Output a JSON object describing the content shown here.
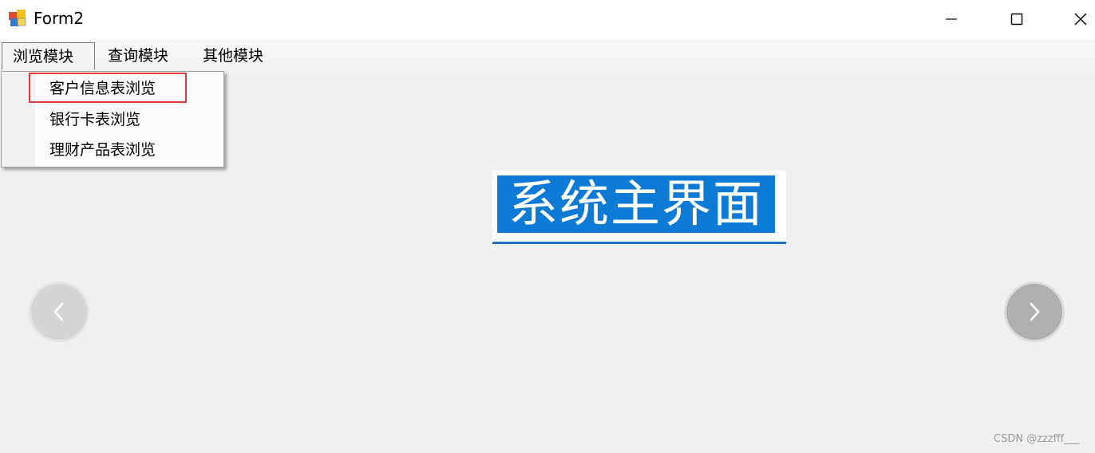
{
  "window": {
    "title": "Form2"
  },
  "menubar": {
    "items": [
      {
        "label": "浏览模块"
      },
      {
        "label": "查询模块"
      },
      {
        "label": "其他模块"
      }
    ]
  },
  "dropdown": {
    "items": [
      {
        "label": "客户信息表浏览"
      },
      {
        "label": "银行卡表浏览"
      },
      {
        "label": "理财产品表浏览"
      }
    ]
  },
  "main": {
    "label": "系统主界面"
  },
  "watermark": "CSDN @zzzfff___",
  "colors": {
    "highlight": "#e03c3c",
    "label_bg": "#0d7ad6",
    "label_text": "#ffffff"
  }
}
